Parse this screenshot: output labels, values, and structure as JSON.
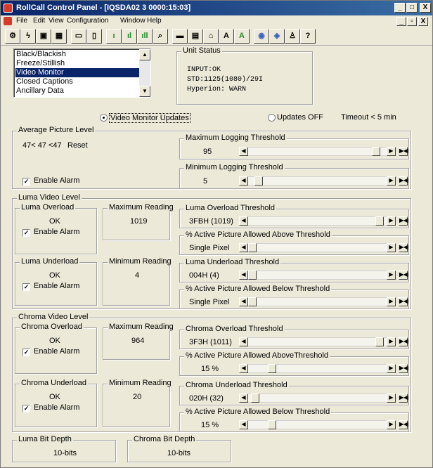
{
  "window": {
    "title": "RollCall Control Panel - [IQSDA02 3 0000:15:03]",
    "controls": {
      "minimize": "_",
      "maximize": "□",
      "close": "X"
    }
  },
  "menubar": {
    "items": [
      "File",
      "Edit",
      "View",
      "Configuration",
      "Window",
      "Help"
    ],
    "mdi_controls": {
      "minimize": "_",
      "restore": "▫",
      "close": "X"
    }
  },
  "toolbar": {
    "buttons": [
      {
        "icon": "config-icon",
        "glyph": "⚙"
      },
      {
        "icon": "wand-icon",
        "glyph": "ϟ"
      },
      {
        "icon": "save-icon",
        "glyph": "▣"
      },
      {
        "icon": "bag-icon",
        "glyph": "▦"
      },
      {
        "icon": "monitor-icon",
        "glyph": "▭"
      },
      {
        "icon": "page-icon",
        "glyph": "▯"
      },
      {
        "icon": "bar1-icon",
        "glyph": "ı"
      },
      {
        "icon": "bar2-icon",
        "glyph": "ıl"
      },
      {
        "icon": "bar3-icon",
        "glyph": "ıll"
      },
      {
        "icon": "search-icon",
        "glyph": "⌕"
      },
      {
        "icon": "display-icon",
        "glyph": "▬"
      },
      {
        "icon": "card-icon",
        "glyph": "▤"
      },
      {
        "icon": "home-icon",
        "glyph": "⌂"
      },
      {
        "icon": "letter-a-icon",
        "glyph": "A"
      },
      {
        "icon": "letter-a-green-icon",
        "glyph": "A"
      },
      {
        "icon": "globe-icon",
        "glyph": "◉"
      },
      {
        "icon": "globe2-icon",
        "glyph": "◈"
      },
      {
        "icon": "people-icon",
        "glyph": "♙"
      },
      {
        "icon": "help-icon",
        "glyph": "?"
      }
    ]
  },
  "list": {
    "items": [
      "Black/Blackish",
      "Freeze/Stillish",
      "Video Monitor",
      "Closed Captions",
      "Ancillary Data"
    ],
    "selected_index": 2
  },
  "unit_status": {
    "title": "Unit Status",
    "lines": [
      "INPUT:OK",
      "STD:1125(1080)/29I",
      "Hyperion: WARN"
    ]
  },
  "updates": {
    "video_monitor_label": "Video Monitor Updates",
    "off_label": "Updates OFF",
    "timeout_label": "Timeout < 5 min"
  },
  "apl": {
    "title": "Average Picture Level",
    "reading": "47< 47 <47",
    "reset_label": "Reset",
    "enable_alarm": "Enable Alarm",
    "max_title": "Maximum Logging Threshold",
    "max_value": "95",
    "max_pos": 0.95,
    "min_title": "Minimum Logging Threshold",
    "min_value": "5",
    "min_pos": 0.05
  },
  "luma": {
    "title": "Luma Video Level",
    "overload_title": "Luma Overload",
    "overload_status": "OK",
    "enable_alarm": "Enable Alarm",
    "max_reading_title": "Maximum Reading",
    "max_reading": "1019",
    "overload_thr_title": "Luma Overload Threshold",
    "overload_thr_value": "3FBH (1019)",
    "overload_thr_pos": 0.98,
    "active_above_title": "% Active Picture Allowed Above Threshold",
    "active_above_value": "Single Pixel",
    "active_above_pos": 0.0,
    "underload_title": "Luma Underload",
    "underload_status": "OK",
    "min_reading_title": "Minimum Reading",
    "min_reading": "4",
    "underload_thr_title": "Luma Underload Threshold",
    "underload_thr_value": "004H (4)",
    "underload_thr_pos": 0.0,
    "active_below_title": "% Active Picture Allowed Below Threshold",
    "active_below_value": "Single Pixel",
    "active_below_pos": 0.0
  },
  "chroma": {
    "title": "Chroma Video Level",
    "overload_title": "Chroma Overload",
    "overload_status": "OK",
    "enable_alarm": "Enable Alarm",
    "max_reading_title": "Maximum Reading",
    "max_reading": "964",
    "overload_thr_title": "Chroma Overload Threshold",
    "overload_thr_value": "3F3H (1011)",
    "overload_thr_pos": 0.98,
    "active_above_title": "% Active Picture Allowed AboveThreshold",
    "active_above_value": "15 %",
    "active_above_pos": 0.15,
    "underload_title": "Chroma Underload",
    "underload_status": "OK",
    "min_reading_title": "Minimum Reading",
    "min_reading": "20",
    "underload_thr_title": "Chroma Underload Threshold",
    "underload_thr_value": "020H (32)",
    "underload_thr_pos": 0.02,
    "active_below_title": "% Active Picture Allowed Below Threshold",
    "active_below_value": "15 %",
    "active_below_pos": 0.15
  },
  "bit_depth": {
    "luma_title": "Luma Bit Depth",
    "luma_value": "10-bits",
    "chroma_title": "Chroma Bit Depth",
    "chroma_value": "10-bits"
  }
}
